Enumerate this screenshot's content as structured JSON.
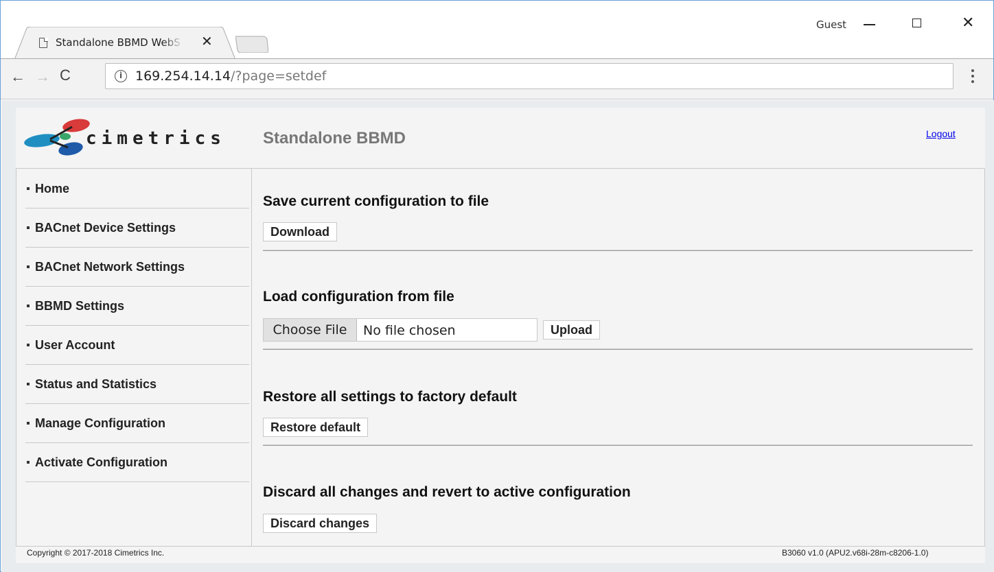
{
  "browser": {
    "tab_title": "Standalone BBMD WebSe",
    "profile": "Guest",
    "url_host": "169.254.14.14",
    "url_path": "/?page=setdef",
    "icons": {
      "tab": "page-icon",
      "close_tab": "close-icon",
      "back": "arrow-left-icon",
      "forward": "arrow-right-icon",
      "reload": "reload-icon",
      "site_info": "info-icon",
      "menu": "vertical-dots-icon"
    }
  },
  "window_controls": {
    "minimize": "minimize-icon",
    "maximize": "maximize-icon",
    "close": "close-icon"
  },
  "header": {
    "logo_text": "cimetrics",
    "app_title": "Standalone BBMD",
    "logout": "Logout"
  },
  "sidebar": {
    "items": [
      {
        "label": "Home"
      },
      {
        "label": "BACnet Device Settings"
      },
      {
        "label": "BACnet Network Settings"
      },
      {
        "label": "BBMD Settings"
      },
      {
        "label": "User Account"
      },
      {
        "label": "Status and Statistics"
      },
      {
        "label": "Manage Configuration"
      },
      {
        "label": "Activate Configuration"
      }
    ]
  },
  "main": {
    "sections": [
      {
        "title": "Save current configuration to file",
        "button": "Download"
      },
      {
        "title": "Load configuration from file",
        "choose_file": "Choose File",
        "file_status": "No file chosen",
        "button": "Upload"
      },
      {
        "title": "Restore all settings to factory default",
        "button": "Restore default"
      },
      {
        "title": "Discard all changes and revert to active configuration",
        "button": "Discard changes"
      }
    ]
  },
  "footer": {
    "copyright": "Copyright © 2017-2018 Cimetrics Inc.",
    "version": "B3060 v1.0 (APU2.v68i-28m-c8206-1.0)"
  },
  "colors": {
    "window_border": "#6aa0d8",
    "link": "#0000ee",
    "logo_red": "#d93a3a",
    "logo_blue": "#1e5aa8",
    "logo_green": "#3aa66a"
  }
}
